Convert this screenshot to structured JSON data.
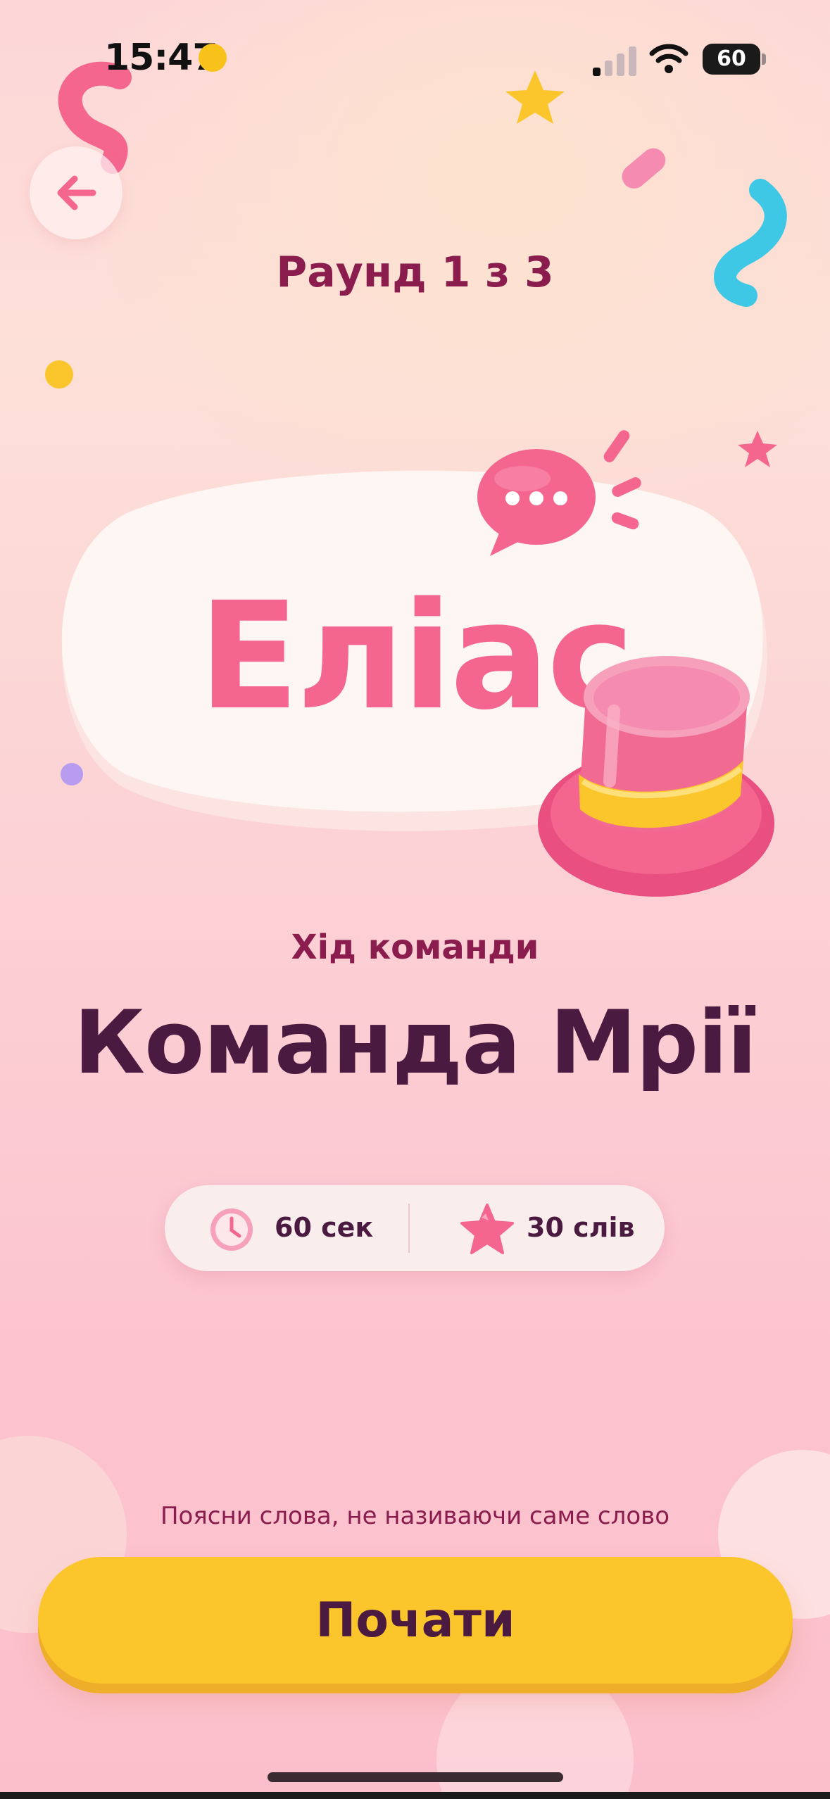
{
  "status_bar": {
    "time": "15:47",
    "battery": "60"
  },
  "header": {
    "round": "Раунд 1 з 3"
  },
  "game": {
    "title": "Еліас"
  },
  "turn": {
    "label": "Хід команди",
    "team": "Команда Мрії"
  },
  "info": {
    "time": "60 сек",
    "words": "30 слів"
  },
  "hint": "Поясни слова, не називаючи саме слово",
  "start_button": {
    "label": "Почати"
  },
  "colors": {
    "accent_pink": "#f4668e",
    "button_yellow": "#fbc52c",
    "text_dark": "#4a1a40",
    "text_maroon": "#8a1d4e"
  },
  "icons": [
    "back-arrow-icon",
    "clock-icon",
    "star-icon",
    "chat-bubble-icon",
    "top-hat-icon"
  ]
}
